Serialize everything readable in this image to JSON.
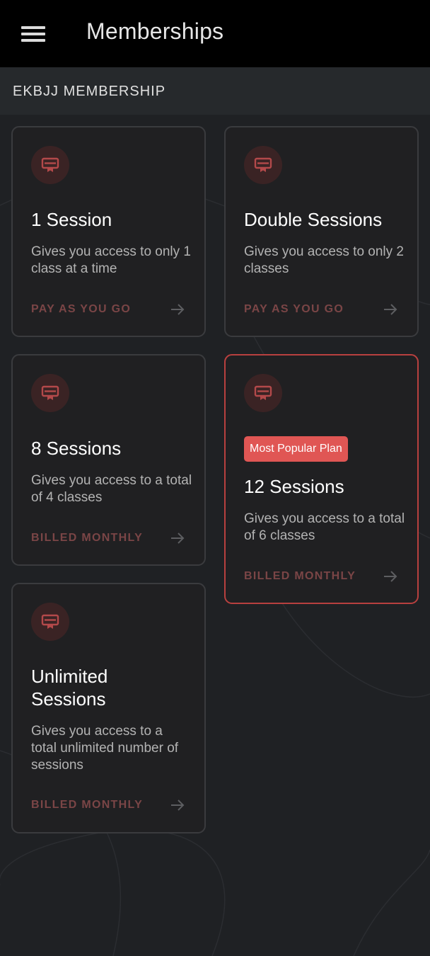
{
  "app_bar": {
    "title": "Memberships",
    "menu_icon": "hamburger-menu-icon"
  },
  "section": {
    "title": "EKBJJ MEMBERSHIP"
  },
  "colors": {
    "accent": "#e05654",
    "popular_border": "#b8403f",
    "billing_text": "#7a4546",
    "icon_bg": "#3a2324"
  },
  "plans": [
    {
      "title": "1 Session",
      "description": "Gives you access to only 1 class at a time",
      "billing": "PAY AS YOU GO",
      "icon": "membership-card-icon"
    },
    {
      "title": "Double Sessions",
      "description": "Gives you access to only 2 classes",
      "billing": "PAY AS YOU GO",
      "icon": "membership-card-icon"
    },
    {
      "title": "8 Sessions",
      "description": "Gives you access to a total of 4 classes",
      "billing": "BILLED MONTHLY",
      "icon": "membership-card-icon"
    },
    {
      "title": "12 Sessions",
      "description": "Gives you access to a total of 6 classes",
      "billing": "BILLED MONTHLY",
      "badge": "Most Popular Plan",
      "icon": "membership-card-icon"
    },
    {
      "title": "Unlimited Sessions",
      "description": "Gives you access to a total unlimited number of sessions",
      "billing": "BILLED MONTHLY",
      "icon": "membership-card-icon"
    }
  ]
}
